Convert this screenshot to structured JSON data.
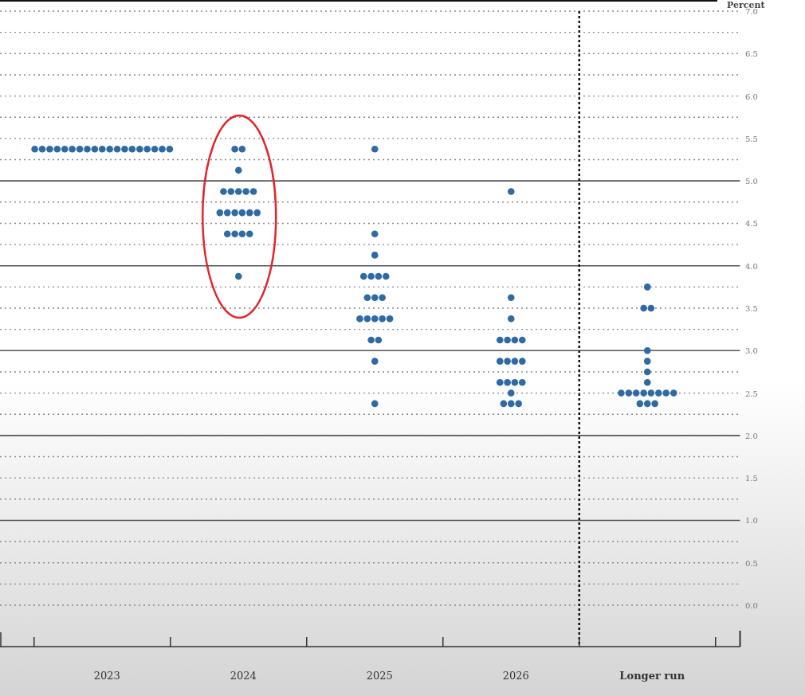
{
  "chart_data": {
    "type": "scatter",
    "ylabel": "Percent",
    "x": [
      2022.505,
      2022.56,
      2022.615,
      2022.67,
      2022.725,
      2022.78,
      2022.835,
      2022.89,
      2022.945,
      2023,
      2023.055,
      2023.11,
      2023.165,
      2023.22,
      2023.275,
      2023.33,
      2023.385,
      2023.44,
      2023.495,
      2023.973,
      2024.027,
      2024,
      2023.89,
      2023.945,
      2024,
      2024.055,
      2024.11,
      2023.863,
      2023.918,
      2023.973,
      2024.027,
      2024.082,
      2024.137,
      2023.918,
      2023.973,
      2024.027,
      2024.082,
      2024,
      2025,
      2025,
      2025,
      2024.918,
      2024.973,
      2025.027,
      2025.082,
      2024.945,
      2025,
      2025.055,
      2024.89,
      2024.945,
      2025,
      2025.055,
      2025.11,
      2024.973,
      2025.027,
      2025,
      2025,
      2026,
      2026,
      2026,
      2025.918,
      2025.973,
      2026.027,
      2026.082,
      2025.918,
      2025.973,
      2026.027,
      2026.082,
      2025.918,
      2025.973,
      2026.027,
      2026.082,
      2026,
      2025.945,
      2026,
      2026.055,
      2027,
      2026.973,
      2027.027,
      2027,
      2027,
      2027,
      2027,
      2026.808,
      2026.863,
      2026.918,
      2026.973,
      2027.027,
      2027.082,
      2027.137,
      2027.193,
      2026.945,
      2027,
      2027.055
    ],
    "series": [
      {
        "color": "#2f6aa3",
        "values": [
          5.375,
          5.375,
          5.375,
          5.375,
          5.375,
          5.375,
          5.375,
          5.375,
          5.375,
          5.375,
          5.375,
          5.375,
          5.375,
          5.375,
          5.375,
          5.375,
          5.375,
          5.375,
          5.375,
          5.375,
          5.375,
          5.125,
          4.875,
          4.875,
          4.875,
          4.875,
          4.875,
          4.625,
          4.625,
          4.625,
          4.625,
          4.625,
          4.625,
          4.375,
          4.375,
          4.375,
          4.375,
          3.875,
          5.375,
          4.375,
          4.125,
          3.875,
          3.875,
          3.875,
          3.875,
          3.625,
          3.625,
          3.625,
          3.375,
          3.375,
          3.375,
          3.375,
          3.375,
          3.125,
          3.125,
          2.875,
          2.375,
          4.875,
          3.625,
          3.375,
          3.125,
          3.125,
          3.125,
          3.125,
          2.875,
          2.875,
          2.875,
          2.875,
          2.625,
          2.625,
          2.625,
          2.625,
          2.5,
          2.375,
          2.375,
          2.375,
          3.75,
          3.5,
          3.5,
          3.0,
          2.875,
          2.75,
          2.625,
          2.5,
          2.5,
          2.5,
          2.5,
          2.5,
          2.5,
          2.5,
          2.5,
          2.375,
          2.375,
          2.375
        ]
      }
    ],
    "xlim": [
      2022.25,
      2027.68
    ],
    "grid": true,
    "ref_lines": [
      {
        "axis": "x",
        "value": 2026.5
      }
    ],
    "xticks": [
      2023,
      2024,
      2025,
      2026,
      {
        "value": 2027,
        "label": "Longer run"
      }
    ],
    "ylim": [
      0,
      7
    ],
    "yticks": [
      {
        "value": 0,
        "label": "0.0"
      },
      {
        "value": 0.5,
        "label": "0.5"
      },
      {
        "value": 1,
        "label": "1.0"
      },
      {
        "value": 1.5,
        "label": "1.5"
      },
      {
        "value": 2,
        "label": "2.0"
      },
      {
        "value": 2.5,
        "label": "2.5"
      },
      {
        "value": 3,
        "label": "3.0"
      },
      {
        "value": 3.5,
        "label": "3.5"
      },
      {
        "value": 4,
        "label": "4.0"
      },
      {
        "value": 4.5,
        "label": "4.5"
      },
      {
        "value": 5,
        "label": "5.0"
      },
      {
        "value": 5.5,
        "label": "5.5"
      },
      {
        "value": 6,
        "label": "6.0"
      },
      {
        "value": 6.5,
        "label": "6.5"
      },
      {
        "value": 7,
        "label": "7.0"
      }
    ]
  }
}
